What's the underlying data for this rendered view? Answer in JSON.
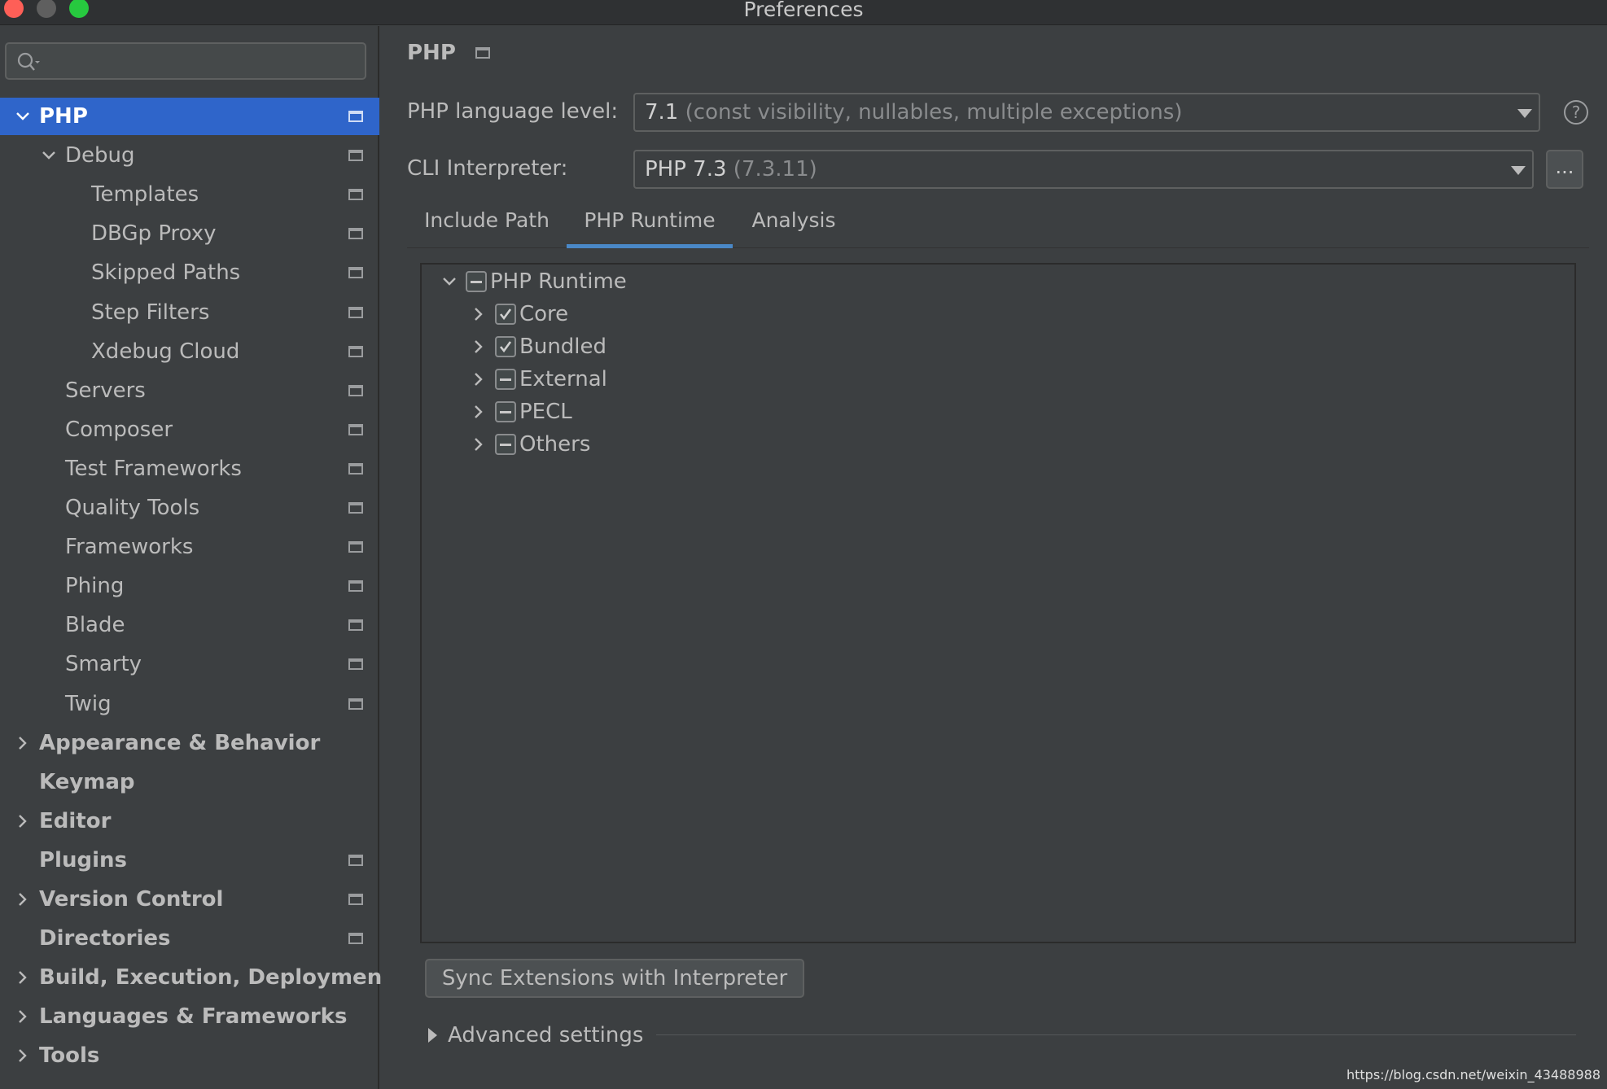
{
  "window": {
    "title": "Preferences"
  },
  "search": {
    "placeholder": ""
  },
  "sidebar": {
    "items": [
      {
        "label": "PHP",
        "level": 0,
        "bold": true,
        "selected": true,
        "expander": "down",
        "icon": true
      },
      {
        "label": "Debug",
        "level": 1,
        "expander": "down",
        "icon": true
      },
      {
        "label": "Templates",
        "level": 2,
        "icon": true
      },
      {
        "label": "DBGp Proxy",
        "level": 2,
        "icon": true
      },
      {
        "label": "Skipped Paths",
        "level": 2,
        "icon": true
      },
      {
        "label": "Step Filters",
        "level": 2,
        "icon": true
      },
      {
        "label": "Xdebug Cloud",
        "level": 2,
        "icon": true
      },
      {
        "label": "Servers",
        "level": 1,
        "icon": true
      },
      {
        "label": "Composer",
        "level": 1,
        "icon": true
      },
      {
        "label": "Test Frameworks",
        "level": 1,
        "icon": true
      },
      {
        "label": "Quality Tools",
        "level": 1,
        "icon": true
      },
      {
        "label": "Frameworks",
        "level": 1,
        "icon": true
      },
      {
        "label": "Phing",
        "level": 1,
        "icon": true
      },
      {
        "label": "Blade",
        "level": 1,
        "icon": true
      },
      {
        "label": "Smarty",
        "level": 1,
        "icon": true
      },
      {
        "label": "Twig",
        "level": 1,
        "icon": true
      },
      {
        "label": "Appearance & Behavior",
        "level": 0,
        "bold": true,
        "expander": "right"
      },
      {
        "label": "Keymap",
        "level": 0,
        "bold": true
      },
      {
        "label": "Editor",
        "level": 0,
        "bold": true,
        "expander": "right"
      },
      {
        "label": "Plugins",
        "level": 0,
        "bold": true,
        "icon": true
      },
      {
        "label": "Version Control",
        "level": 0,
        "bold": true,
        "expander": "right",
        "icon": true
      },
      {
        "label": "Directories",
        "level": 0,
        "bold": true,
        "icon": true
      },
      {
        "label": "Build, Execution, Deployment",
        "level": 0,
        "bold": true,
        "expander": "right"
      },
      {
        "label": "Languages & Frameworks",
        "level": 0,
        "bold": true,
        "expander": "right"
      },
      {
        "label": "Tools",
        "level": 0,
        "bold": true,
        "expander": "right"
      }
    ]
  },
  "main": {
    "breadcrumb": "PHP",
    "language_level": {
      "label": "PHP language level:",
      "value": "7.1",
      "hint": "(const visibility, nullables, multiple exceptions)"
    },
    "interpreter": {
      "label": "CLI Interpreter:",
      "value": "PHP 7.3",
      "hint": "(7.3.11)",
      "browse_label": "..."
    },
    "help_label": "?",
    "tabs": [
      {
        "label": "Include Path",
        "active": false
      },
      {
        "label": "PHP Runtime",
        "active": true
      },
      {
        "label": "Analysis",
        "active": false
      }
    ],
    "runtime_tree": {
      "root": {
        "label": "PHP Runtime",
        "state": "partial"
      },
      "children": [
        {
          "label": "Core",
          "state": "checked"
        },
        {
          "label": "Bundled",
          "state": "checked"
        },
        {
          "label": "External",
          "state": "partial"
        },
        {
          "label": "PECL",
          "state": "partial"
        },
        {
          "label": "Others",
          "state": "partial"
        }
      ]
    },
    "sync_button": "Sync Extensions with Interpreter",
    "advanced_settings": "Advanced settings"
  },
  "watermark": "https://blog.csdn.net/weixin_43488988"
}
